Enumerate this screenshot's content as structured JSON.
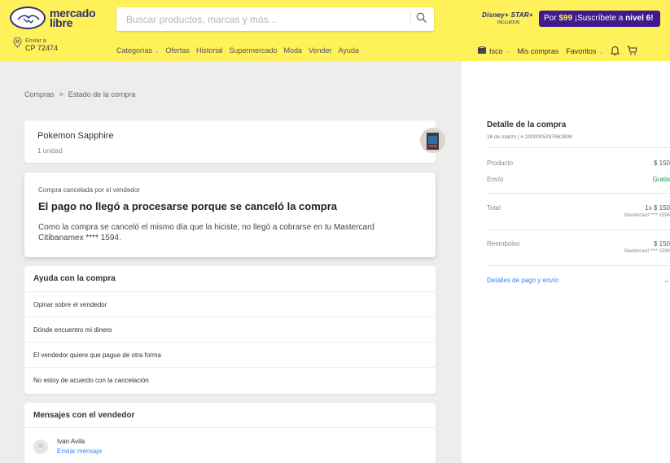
{
  "header": {
    "logo_line1": "mercado",
    "logo_line2": "libre",
    "search_placeholder": "Buscar productos, marcas y más...",
    "promo_brand": "Disney+ STAR+",
    "promo_included": "INCLUIDOS",
    "promo_pre": "Por ",
    "promo_price": "$99",
    "promo_mid": " ¡Suscríbete a ",
    "promo_level": "nivel 6!",
    "ship_label": "Enviar a",
    "ship_cp": "CP 72474",
    "nav": [
      "Categorías",
      "Ofertas",
      "Historial",
      "Supermercado",
      "Moda",
      "Vender",
      "Ayuda"
    ],
    "user_name": "Isco",
    "my_purchases": "Mis compras",
    "favorites": "Favoritos"
  },
  "breadcrumb": {
    "root": "Compras",
    "separator": ">",
    "current": "Estado de la compra"
  },
  "product": {
    "title": "Pokemon Sapphire",
    "quantity": "1 unidad"
  },
  "status": {
    "label": "Compra cancelada por el vendedor",
    "title": "El pago no llegó a procesarse porque se canceló la compra",
    "description": "Como la compra se canceló el mismo día que la hiciste, no llegó a cobrarse en tu Mastercard Citibanamex **** 1594."
  },
  "help": {
    "title": "Ayuda con la compra",
    "items": [
      "Opinar sobre el vendedor",
      "Dónde encuentro mi dinero",
      "El vendedor quiere que pague de otra forma",
      "No estoy de acuerdo con la cancelación"
    ]
  },
  "messages": {
    "title": "Mensajes con el vendedor",
    "seller_initials": "IA",
    "seller_name": "Ivan Avila",
    "send_message": "Enviar mensaje"
  },
  "detail": {
    "title": "Detalle de la compra",
    "meta": "16 de marzo | # 2000005297662808",
    "product_label": "Producto",
    "product_value": "$ 150",
    "shipping_label": "Envío",
    "shipping_value": "Gratis",
    "total_label": "Total",
    "total_value": "1x $ 150",
    "total_card": "Mastercard **** 1594",
    "refund_label": "Reembolso",
    "refund_value": "$ 150",
    "refund_card": "Mastercard **** 1594",
    "link": "Detalles de pago y envío"
  },
  "colors": {
    "header_bg": "#fff159",
    "page_bg": "#ededed",
    "link": "#3483fa",
    "success": "#00a650",
    "promo_bg": "#40198c"
  }
}
